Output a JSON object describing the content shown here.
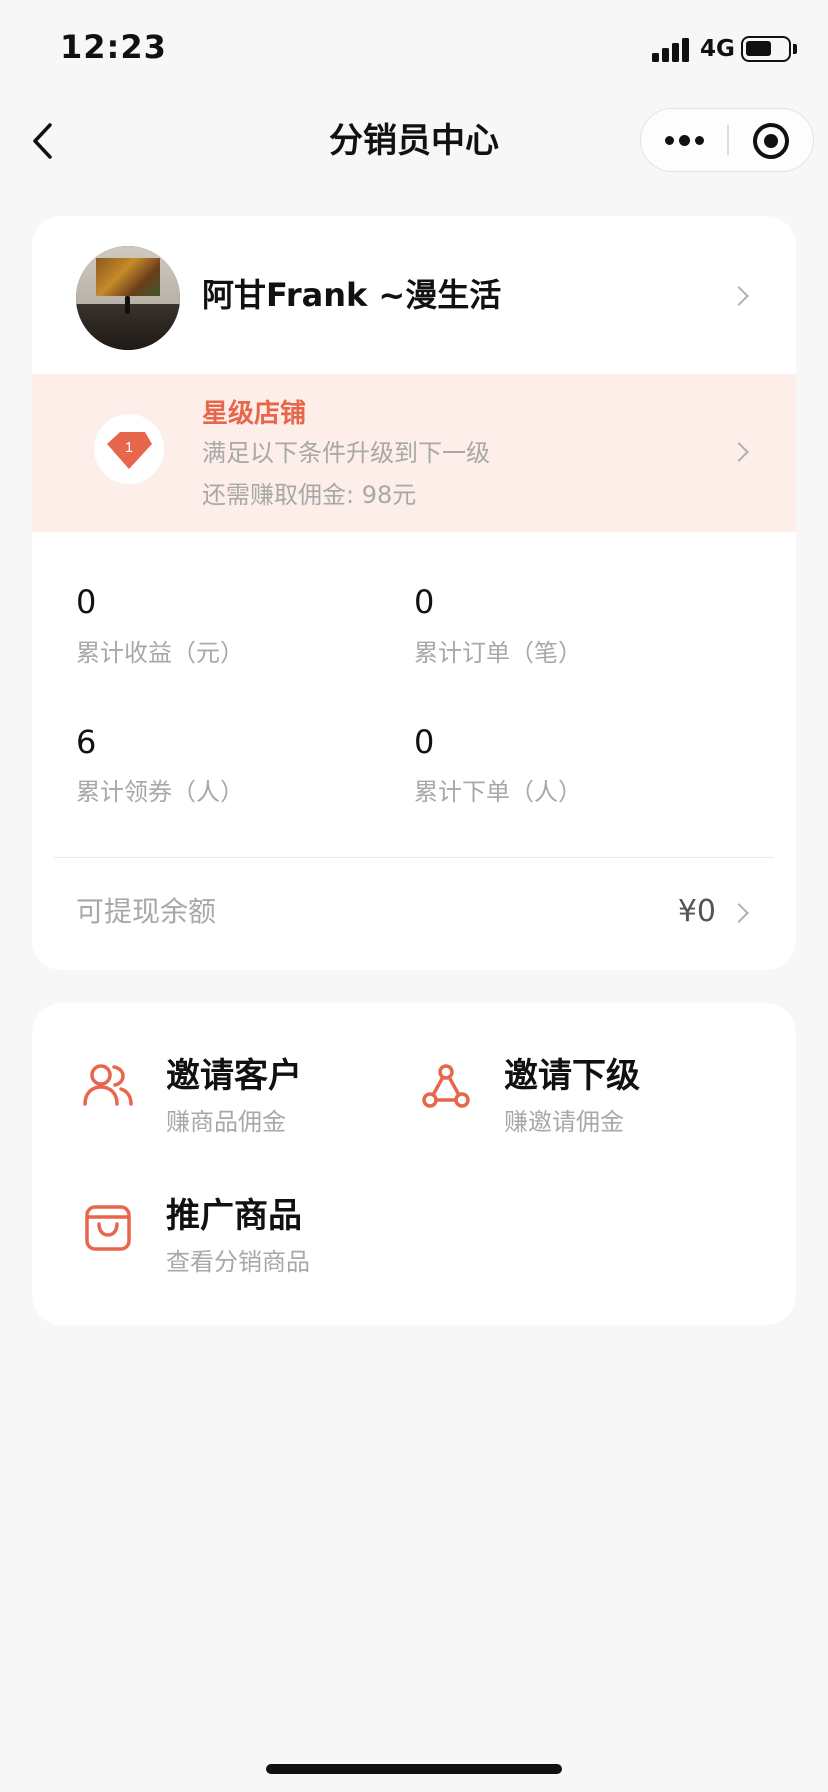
{
  "status_bar": {
    "time": "12:23",
    "network": "4G",
    "battery_level": 0.55
  },
  "nav": {
    "title": "分销员中心"
  },
  "profile": {
    "name": "阿甘Frank ~漫生活"
  },
  "level": {
    "badge_number": "1",
    "title": "星级店铺",
    "description": "满足以下条件升级到下一级",
    "requirement": "还需赚取佣金: 98元"
  },
  "stats": [
    {
      "value": "0",
      "label": "累计收益（元）"
    },
    {
      "value": "0",
      "label": "累计订单（笔）"
    },
    {
      "value": "6",
      "label": "累计领券（人）"
    },
    {
      "value": "0",
      "label": "累计下单（人）"
    }
  ],
  "balance": {
    "label": "可提现余额",
    "value": "¥0"
  },
  "actions": [
    {
      "title": "邀请客户",
      "subtitle": "赚商品佣金",
      "icon": "users-icon"
    },
    {
      "title": "邀请下级",
      "subtitle": "赚邀请佣金",
      "icon": "share-nodes-icon"
    },
    {
      "title": "推广商品",
      "subtitle": "查看分销商品",
      "icon": "shopping-bag-icon"
    }
  ],
  "colors": {
    "accent": "#e8664c",
    "banner_bg": "#fdeee9",
    "page_bg": "#f7f7f7"
  }
}
